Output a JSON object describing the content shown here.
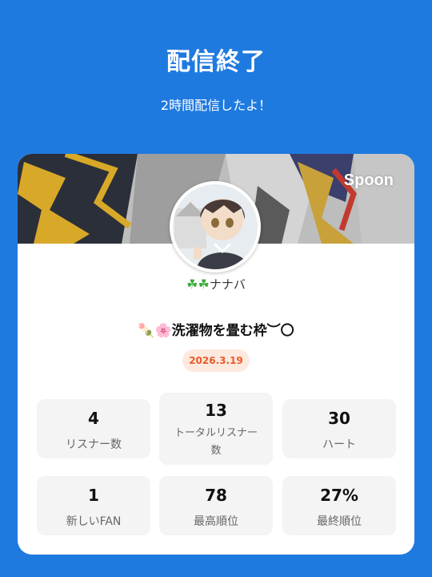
{
  "header": {
    "title": "配信終了",
    "subtitle": "2時間配信したよ！"
  },
  "card": {
    "brand": "Spoon",
    "user": {
      "icon_prefix": "☘☘",
      "name": "ナナバ"
    },
    "topic": {
      "prefix_emoji": "🍡🌸",
      "text": "洗濯物を畳む枠︶〇"
    },
    "date": "2026.3.19",
    "stats": [
      {
        "value": "4",
        "label": "リスナー数"
      },
      {
        "value": "13",
        "label": "トータルリスナー数"
      },
      {
        "value": "30",
        "label": "ハート"
      },
      {
        "value": "1",
        "label": "新しいFAN"
      },
      {
        "value": "78",
        "label": "最高順位"
      },
      {
        "value": "27%",
        "label": "最終順位"
      }
    ]
  },
  "colors": {
    "background": "#1f7ae0",
    "badge_text": "#ea5a2a",
    "badge_bg": "#fde9de"
  }
}
